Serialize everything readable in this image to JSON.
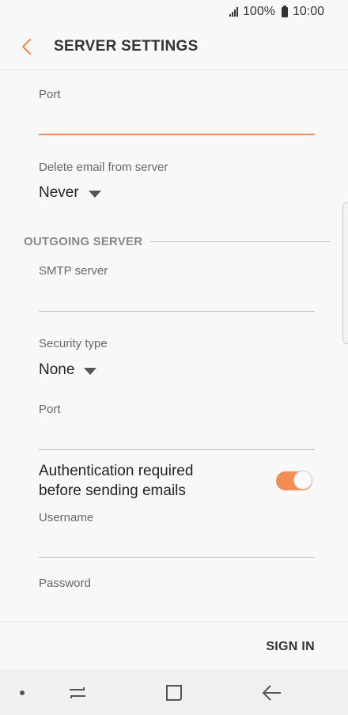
{
  "status_bar": {
    "battery": "100%",
    "time": "10:00"
  },
  "header": {
    "title": "SERVER SETTINGS",
    "back_icon": "chevron-left-icon"
  },
  "incoming": {
    "port_label": "Port",
    "port_value": "",
    "delete_label": "Delete email from server",
    "delete_value": "Never"
  },
  "outgoing": {
    "section_title": "OUTGOING SERVER",
    "smtp_label": "SMTP server",
    "smtp_value": "",
    "security_label": "Security type",
    "security_value": "None",
    "port_label": "Port",
    "port_value": "",
    "auth_label_line1": "Authentication required",
    "auth_label_line2": "before sending emails",
    "auth_enabled": true,
    "username_label": "Username",
    "username_value": "",
    "password_label": "Password"
  },
  "footer": {
    "sign_in_label": "SIGN IN"
  },
  "nav_bar": {
    "icons": [
      "dot-icon",
      "recent-apps-icon",
      "home-icon",
      "back-arrow-icon"
    ]
  },
  "colors": {
    "accent": "#f28d53",
    "divider": "#bdbdbd"
  }
}
